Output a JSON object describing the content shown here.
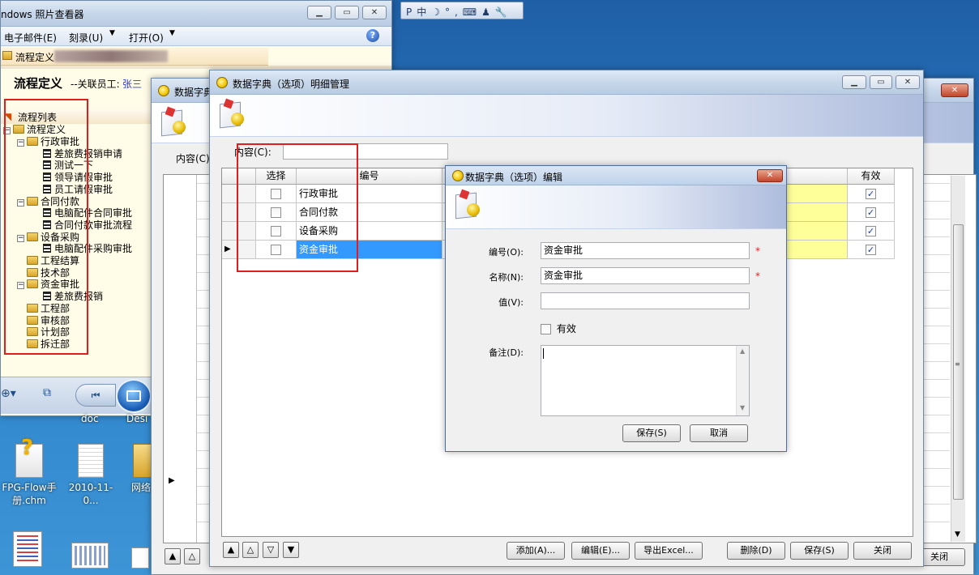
{
  "langbar": {
    "items": [
      "P",
      "中",
      "☽",
      "°,",
      "⌨",
      "♟",
      "🔧"
    ]
  },
  "photo_viewer": {
    "title": "ndows 照片查看器",
    "menu": [
      "电子邮件(E)",
      "刻录(U)",
      "打开(O)"
    ],
    "tab_label": "流程定义",
    "page_title": "流程定义",
    "employee_prefix": "--关联员工:",
    "employee_name": "张三"
  },
  "process_tree": {
    "header": "流程列表",
    "root": "流程定义",
    "items": [
      {
        "label": "行政审批",
        "level": 1,
        "type": "folder",
        "expanded": true
      },
      {
        "label": "差旅费报销申请",
        "level": 2,
        "type": "doc"
      },
      {
        "label": "测试一下",
        "level": 2,
        "type": "doc"
      },
      {
        "label": "领导请假审批",
        "level": 2,
        "type": "doc"
      },
      {
        "label": "员工请假审批",
        "level": 2,
        "type": "doc"
      },
      {
        "label": "合同付款",
        "level": 1,
        "type": "folder",
        "expanded": true
      },
      {
        "label": "电脑配件合同审批",
        "level": 2,
        "type": "doc"
      },
      {
        "label": "合同付款审批流程",
        "level": 2,
        "type": "doc"
      },
      {
        "label": "设备采购",
        "level": 1,
        "type": "folder",
        "expanded": true
      },
      {
        "label": "电脑配件采购审批",
        "level": 2,
        "type": "doc"
      },
      {
        "label": "工程结算",
        "level": 1,
        "type": "folder"
      },
      {
        "label": "技术部",
        "level": 1,
        "type": "folder"
      },
      {
        "label": "资金审批",
        "level": 1,
        "type": "folder",
        "expanded": true
      },
      {
        "label": "差旅费报销",
        "level": 2,
        "type": "doc"
      },
      {
        "label": "工程部",
        "level": 1,
        "type": "folder"
      },
      {
        "label": "审核部",
        "level": 1,
        "type": "folder"
      },
      {
        "label": "计划部",
        "level": 1,
        "type": "folder"
      },
      {
        "label": "拆迁部",
        "level": 1,
        "type": "folder"
      }
    ]
  },
  "desktop": {
    "icons": [
      {
        "label": "FPG-Flow手册.chm"
      },
      {
        "label": "2010-11-0..."
      },
      {
        "label": "网络"
      }
    ],
    "partial_labels": [
      "doc",
      "Desi"
    ]
  },
  "back_window": {
    "title": "数据字典",
    "content_label": "内容(C)",
    "close_label": "关闭"
  },
  "detail_window": {
    "title": "数据字典（选项）明细管理",
    "content_label": "内容(C):",
    "content_value": "",
    "columns": {
      "select": "选择",
      "code": "编号",
      "valid": "有效"
    },
    "rows": [
      {
        "code": "行政审批",
        "selected": false,
        "valid": true
      },
      {
        "code": "合同付款",
        "selected": false,
        "valid": true
      },
      {
        "code": "设备采购",
        "selected": false,
        "valid": true
      },
      {
        "code": "资金审批",
        "selected": false,
        "valid": true,
        "current": true
      }
    ],
    "buttons": {
      "add": "添加(A)...",
      "edit": "编辑(E)...",
      "export": "导出Excel...",
      "delete": "删除(D)",
      "save": "保存(S)",
      "close": "关闭"
    }
  },
  "edit_dialog": {
    "title": "数据字典（选项）编辑",
    "fields": {
      "code_label": "编号(O):",
      "code_value": "资金审批",
      "name_label": "名称(N):",
      "name_value": "资金审批",
      "value_label": "值(V):",
      "value_value": "",
      "valid_label": "有效",
      "remark_label": "备注(D):",
      "remark_value": ""
    },
    "required_mark": "*",
    "buttons": {
      "save": "保存(S)",
      "cancel": "取消"
    }
  },
  "colors": {
    "highlight": "#3399ff",
    "yellow_cell": "#ffff99",
    "red_annotation": "#e01e1e"
  }
}
